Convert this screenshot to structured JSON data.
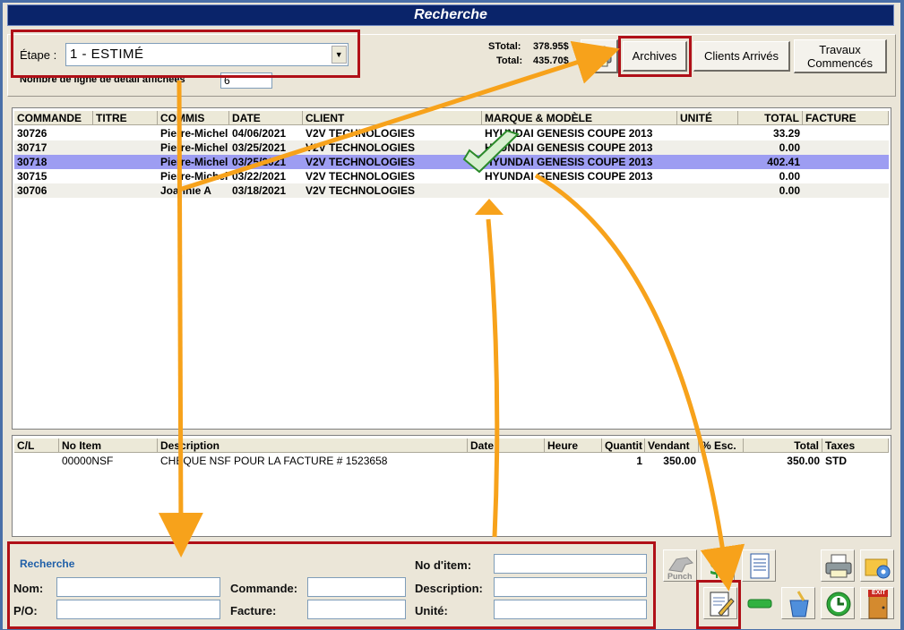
{
  "window": {
    "title": "Recherche"
  },
  "top": {
    "etape_label": "Étape :",
    "etape_value": "1 - ESTIMÉ",
    "nb_lignes_label": "Nombre de ligne de détail affichées",
    "nb_lignes_value": "6",
    "stotal_label": "STotal:",
    "stotal_value": "378.95$",
    "total_label": "Total:",
    "total_value": "435.70$",
    "archives_label": "Archives",
    "clients_label": "Clients Arrivés",
    "travaux_label_1": "Travaux",
    "travaux_label_2": "Commencés"
  },
  "orders": {
    "columns": [
      "COMMANDE",
      "TITRE",
      "COMMIS",
      "DATE",
      "CLIENT",
      "MARQUE & MODÈLE",
      "UNITÉ",
      "TOTAL",
      "FACTURE"
    ],
    "rows": [
      {
        "commande": "30726",
        "titre": "",
        "commis": "Pierre-Michel",
        "date": "04/06/2021",
        "client": "V2V TECHNOLOGIES",
        "marque": "HYUNDAI GENESIS COUPE 2013",
        "unite": "",
        "total": "33.29",
        "facture": ""
      },
      {
        "commande": "30717",
        "titre": "",
        "commis": "Pierre-Michel",
        "date": "03/25/2021",
        "client": "V2V TECHNOLOGIES",
        "marque": "HYUNDAI GENESIS COUPE 2013",
        "unite": "",
        "total": "0.00",
        "facture": ""
      },
      {
        "commande": "30718",
        "titre": "",
        "commis": "Pierre-Michel",
        "date": "03/25/2021",
        "client": "V2V TECHNOLOGIES",
        "marque": "HYUNDAI GENESIS COUPE 2013",
        "unite": "",
        "total": "402.41",
        "facture": ""
      },
      {
        "commande": "30715",
        "titre": "",
        "commis": "Pierre-Michel",
        "date": "03/22/2021",
        "client": "V2V TECHNOLOGIES",
        "marque": "HYUNDAI GENESIS COUPE 2013",
        "unite": "",
        "total": "0.00",
        "facture": ""
      },
      {
        "commande": "30706",
        "titre": "",
        "commis": "Joannie A",
        "date": "03/18/2021",
        "client": "V2V TECHNOLOGIES",
        "marque": "",
        "unite": "",
        "total": "0.00",
        "facture": ""
      }
    ]
  },
  "details": {
    "columns": [
      "C/L",
      "No Item",
      "Description",
      "Date",
      "Heure",
      "Quantit",
      "Vendant",
      "% Esc.",
      "Total",
      "Taxes"
    ],
    "rows": [
      {
        "cl": "",
        "no_item": "00000NSF",
        "description": "CHEQUE NSF POUR LA FACTURE # 1523658",
        "date": "",
        "heure": "",
        "quantite": "1",
        "vendant": "350.00",
        "esc": "",
        "total": "350.00",
        "taxes": "STD"
      }
    ]
  },
  "search": {
    "title": "Recherche",
    "nom_label": "Nom:",
    "po_label": "P/O:",
    "commande_label": "Commande:",
    "facture_label": "Facture:",
    "noitem_label": "No d'item:",
    "description_label": "Description:",
    "unite_label": "Unité:"
  },
  "toolbar": {
    "punch_label": "Punch",
    "exit_label": "EXIT"
  },
  "colors": {
    "highlight_box": "#b01018",
    "arrow": "#f7a21b",
    "selected_row": "#9d9df2",
    "title_bar": "#0a246a"
  }
}
